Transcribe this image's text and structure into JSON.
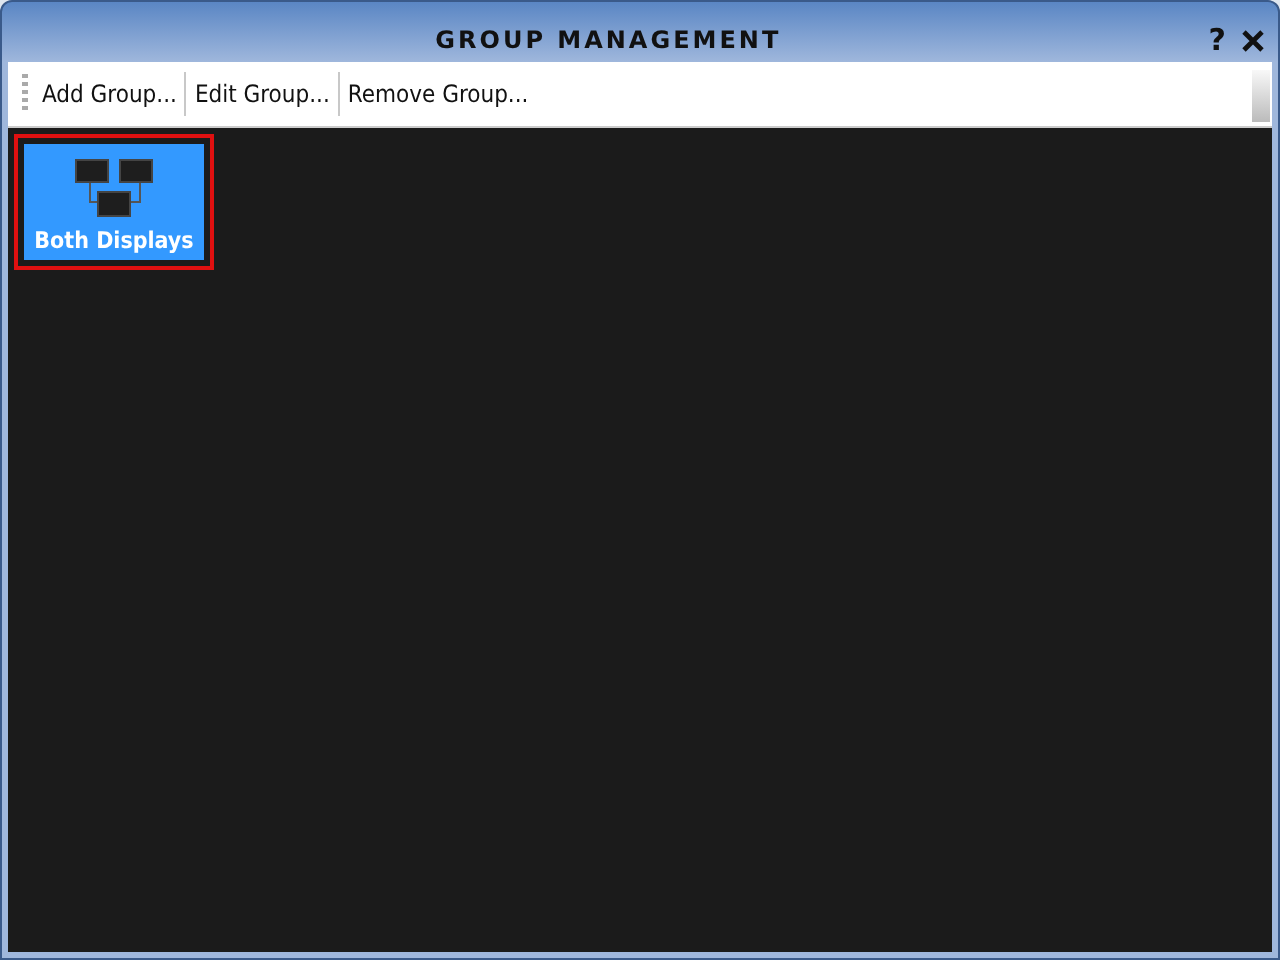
{
  "window": {
    "title": "GROUP MANAGEMENT",
    "help": "?"
  },
  "toolbar": [
    {
      "label": "Add Group..."
    },
    {
      "label": "Edit Group..."
    },
    {
      "label": "Remove Group..."
    }
  ],
  "groups": [
    {
      "label": "Both Displays",
      "selected": true
    }
  ]
}
